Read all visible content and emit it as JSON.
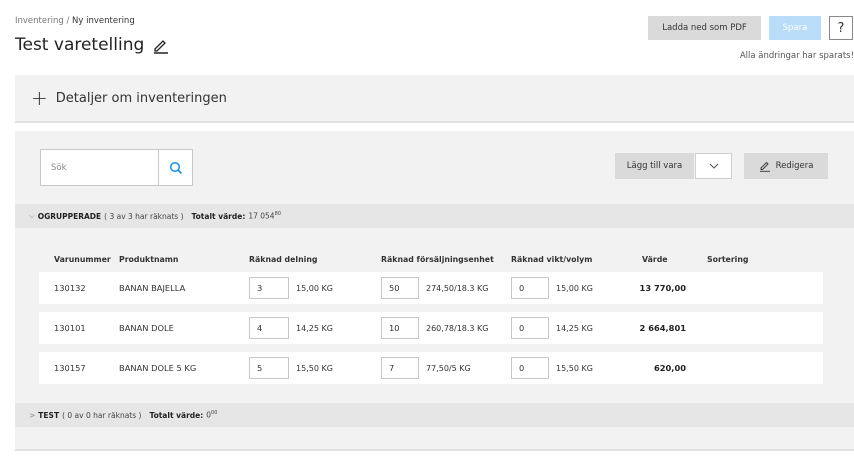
{
  "breadcrumb": {
    "parent": "Inventering",
    "separator": "/",
    "current": "Ny inventering"
  },
  "page": {
    "title": "Test varetelling"
  },
  "header": {
    "pdf_label": "Ladda ned som PDF",
    "save_label": "Spara",
    "help_label": "?",
    "saved_note": "Alla ändringar har sparats!"
  },
  "details": {
    "plus": "+",
    "title": "Detaljer om inventeringen"
  },
  "toolbar": {
    "search_placeholder": "Sök",
    "add_item_label": "Lägg till vara",
    "edit_label": "Redigera"
  },
  "groups": [
    {
      "chevron": "⌵",
      "name": "OGRUPPERADE",
      "count_text": "( 3 av 3 har räknats )",
      "total_label": "Totalt värde:",
      "total_value": "17 054",
      "total_sup": "80"
    },
    {
      "chevron": ">",
      "name": "TEST",
      "count_text": "( 0 av 0 har räknats )",
      "total_label": "Totalt värde:",
      "total_value": "0",
      "total_sup": "00"
    }
  ],
  "table": {
    "columns": [
      "Varunummer",
      "Produktnamn",
      "Räknad delning",
      "Räknad försäljningsenhet",
      "Räknad vikt/volym",
      "Värde",
      "Sortering"
    ],
    "rows": [
      {
        "number": "130132",
        "name": "BANAN BAJELLA",
        "split_qty": "3",
        "split_unit": "15,00 KG",
        "sales_qty": "50",
        "sales_unit": "274,50/18.3 KG",
        "weight_qty": "0",
        "weight_unit": "15,00 KG",
        "value": "13 770,00"
      },
      {
        "number": "130101",
        "name": "BANAN DOLE",
        "split_qty": "4",
        "split_unit": "14,25 KG",
        "sales_qty": "10",
        "sales_unit": "260,78/18.3 KG",
        "weight_qty": "0",
        "weight_unit": "14,25 KG",
        "value": "2 664,801"
      },
      {
        "number": "130157",
        "name": "BANAN DOLE 5 KG",
        "split_qty": "5",
        "split_unit": "15,50 KG",
        "sales_qty": "7",
        "sales_unit": "77,50/5 KG",
        "weight_qty": "0",
        "weight_unit": "15,50 KG",
        "value": "620,00"
      }
    ]
  },
  "colors": {
    "accent": "#1a8fe0",
    "save_disabled": "#b9dcf8",
    "panel_bg": "#f2f2f2",
    "group_bg": "#e6e6e6"
  },
  "icons": {
    "title_edit": "pencil-icon",
    "search": "search-icon",
    "dropdown": "chevron-down-icon",
    "edit": "pencil-icon",
    "expand": "plus-icon"
  }
}
